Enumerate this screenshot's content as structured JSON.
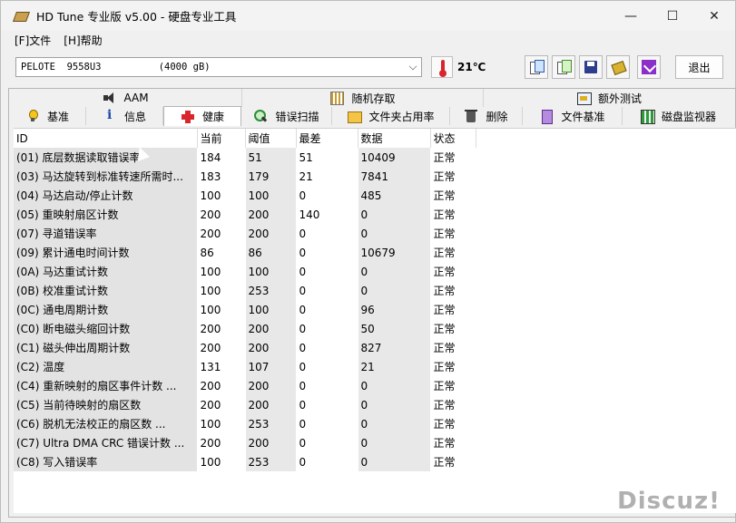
{
  "window": {
    "title": "HD Tune 专业版 v5.00 - 硬盘专业工具",
    "minimize": "—",
    "maximize": "☐",
    "close": "✕"
  },
  "menu": {
    "file": "[F]文件",
    "help": "[H]帮助"
  },
  "toolbar": {
    "drive": "PELOTE  9558U3          (4000 gB)",
    "temperature": "21℃",
    "exit_label": "退出"
  },
  "tabs_row1": [
    {
      "label": "AAM",
      "icon": "speaker-icon"
    },
    {
      "label": "随机存取",
      "icon": "grid-icon"
    },
    {
      "label": "额外测试",
      "icon": "meter-icon"
    }
  ],
  "tabs_row2": [
    {
      "label": "基准",
      "icon": "bulb-icon"
    },
    {
      "label": "信息",
      "icon": "info-icon"
    },
    {
      "label": "健康",
      "icon": "health-cross-icon",
      "active": true
    },
    {
      "label": "错误扫描",
      "icon": "magnifier-icon"
    },
    {
      "label": "文件夹占用率",
      "icon": "folder-icon"
    },
    {
      "label": "删除",
      "icon": "trash-icon"
    },
    {
      "label": "文件基准",
      "icon": "file-icon"
    },
    {
      "label": "磁盘监视器",
      "icon": "chart-icon"
    }
  ],
  "table": {
    "headers": {
      "id": "ID",
      "current": "当前",
      "threshold": "阈值",
      "worst": "最差",
      "data": "数据",
      "status": "状态"
    },
    "rows": [
      {
        "id": "(01) 底层数据读取错误率",
        "current": "184",
        "threshold": "51",
        "worst": "51",
        "data": "10409",
        "status": "正常"
      },
      {
        "id": "(03) 马达旋转到标准转速所需时...",
        "current": "183",
        "threshold": "179",
        "worst": "21",
        "data": "7841",
        "status": "正常"
      },
      {
        "id": "(04) 马达启动/停止计数",
        "current": "100",
        "threshold": "100",
        "worst": "0",
        "data": "485",
        "status": "正常"
      },
      {
        "id": "(05) 重映射扇区计数",
        "current": "200",
        "threshold": "200",
        "worst": "140",
        "data": "0",
        "status": "正常"
      },
      {
        "id": "(07) 寻道错误率",
        "current": "200",
        "threshold": "200",
        "worst": "0",
        "data": "0",
        "status": "正常"
      },
      {
        "id": "(09) 累计通电时间计数",
        "current": "86",
        "threshold": "86",
        "worst": "0",
        "data": "10679",
        "status": "正常"
      },
      {
        "id": "(0A) 马达重试计数",
        "current": "100",
        "threshold": "100",
        "worst": "0",
        "data": "0",
        "status": "正常"
      },
      {
        "id": "(0B) 校准重试计数",
        "current": "100",
        "threshold": "253",
        "worst": "0",
        "data": "0",
        "status": "正常"
      },
      {
        "id": "(0C) 通电周期计数",
        "current": "100",
        "threshold": "100",
        "worst": "0",
        "data": "96",
        "status": "正常"
      },
      {
        "id": "(C0) 断电磁头缩回计数",
        "current": "200",
        "threshold": "200",
        "worst": "0",
        "data": "50",
        "status": "正常"
      },
      {
        "id": "(C1) 磁头伸出周期计数",
        "current": "200",
        "threshold": "200",
        "worst": "0",
        "data": "827",
        "status": "正常"
      },
      {
        "id": "(C2) 温度",
        "current": "131",
        "threshold": "107",
        "worst": "0",
        "data": "21",
        "status": "正常"
      },
      {
        "id": "(C4) 重新映射的扇区事件计数 ...",
        "current": "200",
        "threshold": "200",
        "worst": "0",
        "data": "0",
        "status": "正常"
      },
      {
        "id": "(C5) 当前待映射的扇区数",
        "current": "200",
        "threshold": "200",
        "worst": "0",
        "data": "0",
        "status": "正常"
      },
      {
        "id": "(C6) 脱机无法校正的扇区数 ...",
        "current": "100",
        "threshold": "253",
        "worst": "0",
        "data": "0",
        "status": "正常"
      },
      {
        "id": "(C7) Ultra DMA CRC 错误计数 ...",
        "current": "200",
        "threshold": "200",
        "worst": "0",
        "data": "0",
        "status": "正常"
      },
      {
        "id": "(C8) 写入错误率",
        "current": "100",
        "threshold": "253",
        "worst": "0",
        "data": "0",
        "status": "正常"
      }
    ]
  },
  "watermark": "Discuz!"
}
